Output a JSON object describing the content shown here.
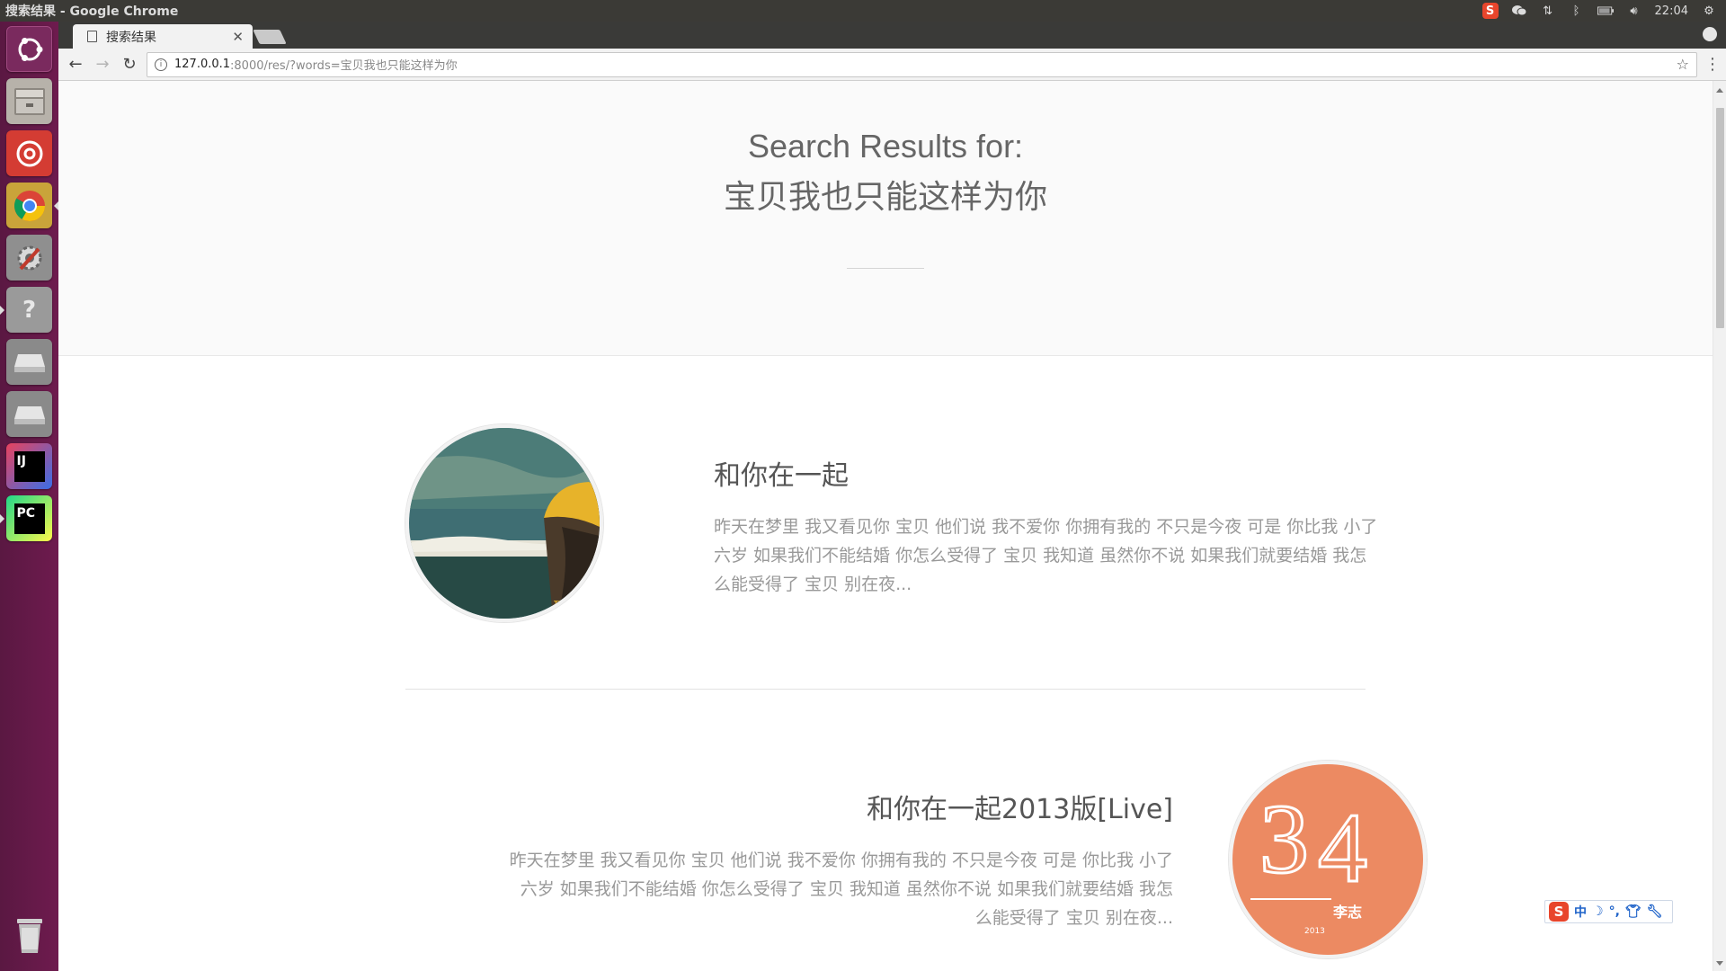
{
  "system": {
    "window_title": "搜索结果 - Google Chrome",
    "clock": "22:04"
  },
  "launcher": {
    "items": [
      {
        "name": "ubuntu-dash-icon",
        "label": ""
      },
      {
        "name": "files-icon",
        "label": ""
      },
      {
        "name": "netease-music-icon",
        "label": ""
      },
      {
        "name": "chrome-icon",
        "label": ""
      },
      {
        "name": "system-settings-icon",
        "label": ""
      },
      {
        "name": "help-icon",
        "label": "?"
      },
      {
        "name": "drive-icon",
        "label": ""
      },
      {
        "name": "drive-icon",
        "label": ""
      },
      {
        "name": "intellij-icon",
        "label": "IJ"
      },
      {
        "name": "pycharm-icon",
        "label": "PC"
      },
      {
        "name": "trash-icon",
        "label": ""
      }
    ]
  },
  "browser": {
    "tab_title": "搜索结果",
    "url_host": "127.0.0.1",
    "url_rest": ":8000/res/?words=宝贝我也只能这样为你"
  },
  "page": {
    "hero_label": "Search Results for:",
    "query": "宝贝我也只能这样为你",
    "results": [
      {
        "title": "和你在一起",
        "lyrics": "昨天在梦里 我又看见你 宝贝 他们说 我不爱你 你拥有我的 不只是今夜 可是 你比我 小了六岁 如果我们不能结婚 你怎么受得了 宝贝 我知道 虽然你不说 如果我们就要结婚 我怎么能受得了 宝贝 别在夜..."
      },
      {
        "title": "和你在一起2013版[Live]",
        "lyrics": "昨天在梦里 我又看见你 宝贝 他们说 我不爱你 你拥有我的 不只是今夜 可是 你比我 小了六岁 如果我们不能结婚 你怎么受得了 宝贝 我知道 虽然你不说 如果我们就要结婚 我怎么能受得了 宝贝 别在夜...",
        "cover_text": "李志"
      }
    ]
  },
  "ime": {
    "logo": "S",
    "mode": "中"
  }
}
